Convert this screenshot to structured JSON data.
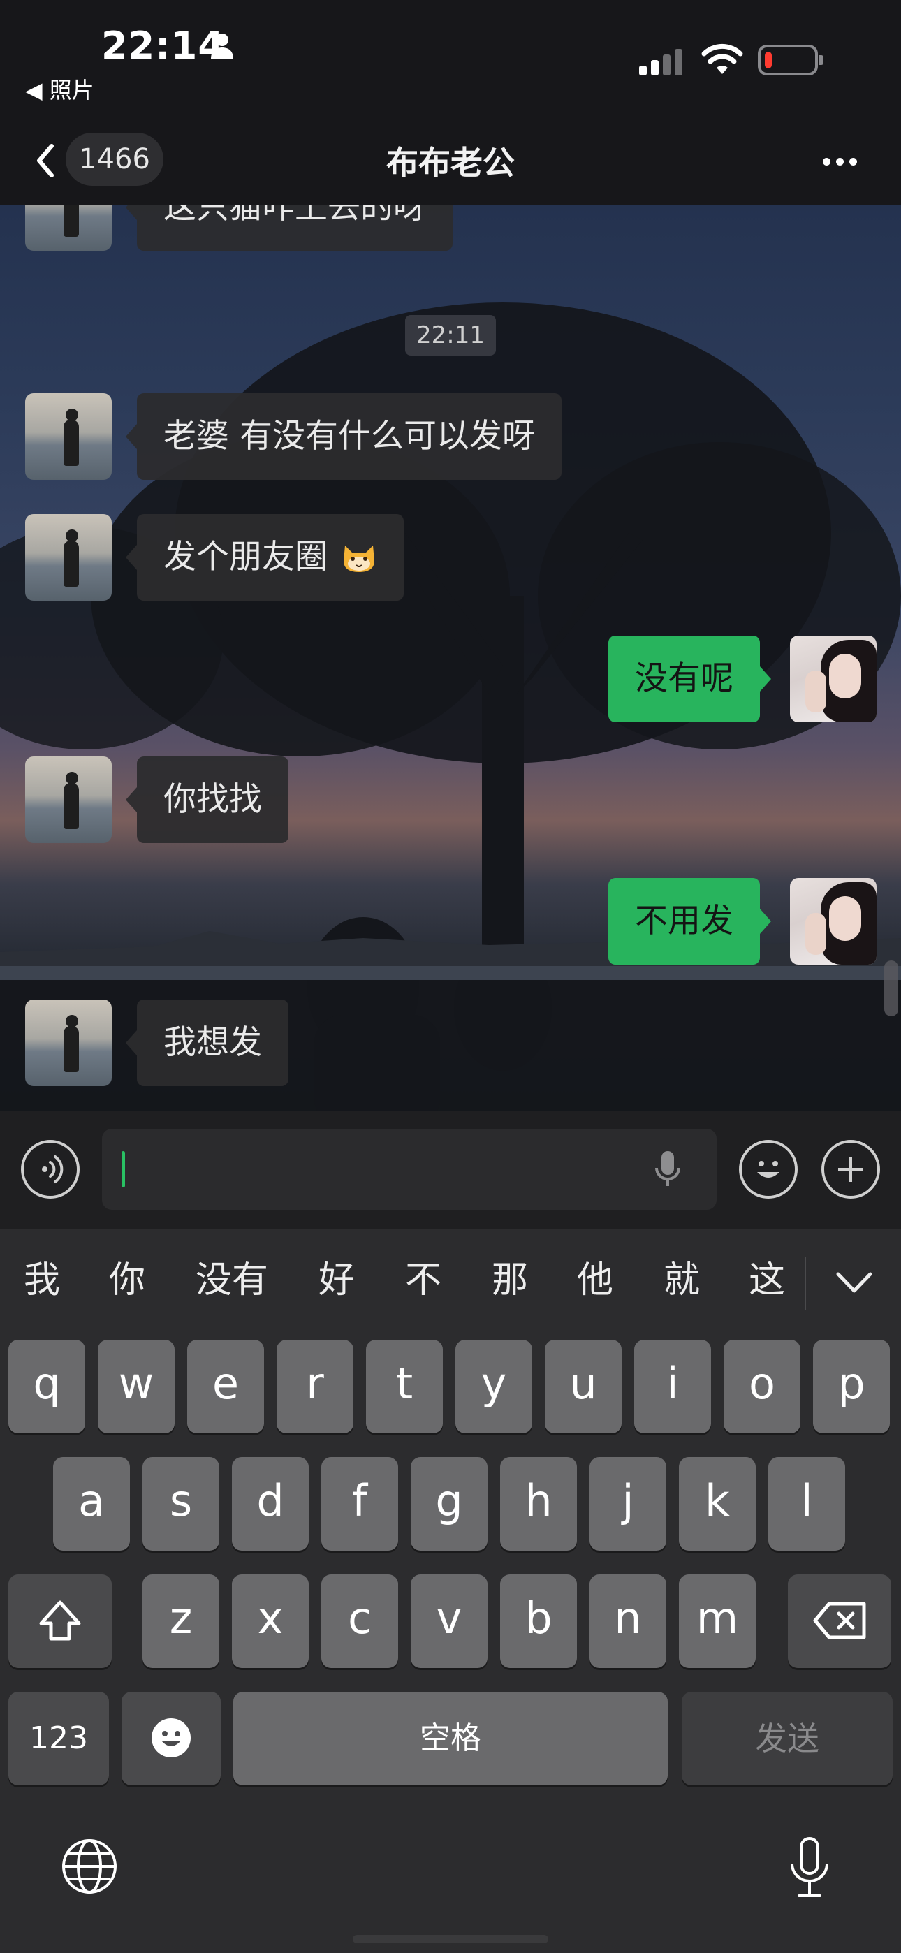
{
  "status_bar": {
    "time": "22:14",
    "back_app": "◀ 照片",
    "battery_color": "#ff3b30"
  },
  "nav": {
    "unread_count": "1466",
    "title": "布布老公",
    "back_icon": "chevron-left-icon",
    "more_icon": "ellipsis-icon"
  },
  "chat": {
    "timestamp": "22:11",
    "messages": [
      {
        "side": "in",
        "text": "这只猫咋上去的呀"
      },
      {
        "side": "in",
        "text": "老婆 有没有什么可以发呀"
      },
      {
        "side": "in",
        "text": "发个朋友圈",
        "emoji": "cat-face-icon"
      },
      {
        "side": "out",
        "text": "没有呢"
      },
      {
        "side": "in",
        "text": "你找找"
      },
      {
        "side": "out",
        "text": "不用发"
      },
      {
        "side": "in",
        "text": "我想发"
      }
    ],
    "outgoing_color": "#28b45d"
  },
  "input_bar": {
    "voice_icon": "voice-icon",
    "mic_icon": "microphone-icon",
    "emoji_icon": "emoji-icon",
    "plus_icon": "plus-icon"
  },
  "keyboard": {
    "candidates": [
      "我",
      "你",
      "没有",
      "好",
      "不",
      "那",
      "他",
      "就",
      "这"
    ],
    "row1": [
      "q",
      "w",
      "e",
      "r",
      "t",
      "y",
      "u",
      "i",
      "o",
      "p"
    ],
    "row2": [
      "a",
      "s",
      "d",
      "f",
      "g",
      "h",
      "j",
      "k",
      "l"
    ],
    "row3": [
      "z",
      "x",
      "c",
      "v",
      "b",
      "n",
      "m"
    ],
    "numbers_key": "123",
    "space_key": "空格",
    "send_key": "发送",
    "globe_icon": "globe-icon",
    "dictation_icon": "microphone-icon"
  }
}
